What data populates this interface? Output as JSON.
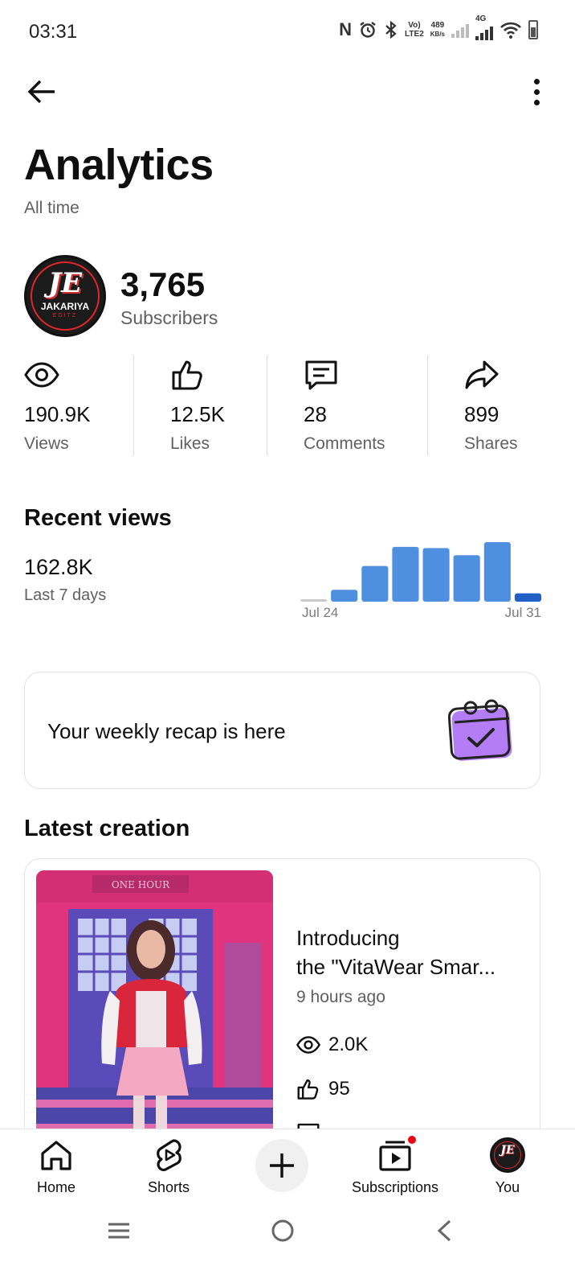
{
  "status_bar": {
    "time": "03:31",
    "volte": "Vo)",
    "lte": "LTE2",
    "speed_value": "489",
    "speed_unit": "KB/s",
    "network": "4G"
  },
  "header": {
    "title": "Analytics",
    "period": "All time"
  },
  "channel": {
    "avatar_text": "JE",
    "avatar_name": "JAKARIYA",
    "avatar_sub": "EDITZ",
    "subscriber_count": "3,765",
    "subscriber_label": "Subscribers"
  },
  "stats": [
    {
      "icon": "eye-icon",
      "value": "190.9K",
      "label": "Views"
    },
    {
      "icon": "thumbs-up-icon",
      "value": "12.5K",
      "label": "Likes"
    },
    {
      "icon": "comment-icon",
      "value": "28",
      "label": "Comments"
    },
    {
      "icon": "share-icon",
      "value": "899",
      "label": "Shares"
    }
  ],
  "recent_views": {
    "title": "Recent views",
    "value": "162.8K",
    "subtitle": "Last 7 days"
  },
  "chart_data": {
    "type": "bar",
    "categories": [
      "1",
      "2",
      "3",
      "4",
      "5",
      "6",
      "7",
      "8"
    ],
    "values": [
      0.04,
      0.2,
      0.6,
      0.92,
      0.9,
      0.78,
      1.0,
      0.14
    ],
    "x_tick_labels": [
      "Jul 24",
      "Jul 31"
    ],
    "colors": {
      "bar": "#4f8fe0",
      "last_bar": "#1f5fc6",
      "first_bar": "#c8c8c8"
    },
    "grid": false
  },
  "recap": {
    "text": "Your weekly recap is here",
    "icon": "calendar-check-icon",
    "icon_color": "#b57df5"
  },
  "latest_creation": {
    "title": "Latest creation",
    "video_title_line1": "Introducing",
    "video_title_line2": "the \"VitaWear Smar...",
    "time_ago": "9 hours ago",
    "views": "2.0K",
    "likes": "95",
    "thumbnail_sign": "ONE HOUR"
  },
  "bottom_nav": {
    "items": [
      {
        "label": "Home",
        "icon": "home-icon"
      },
      {
        "label": "Shorts",
        "icon": "shorts-icon"
      },
      {
        "label": "",
        "icon": "plus-icon"
      },
      {
        "label": "Subscriptions",
        "icon": "subscriptions-icon"
      },
      {
        "label": "You",
        "icon": "avatar"
      }
    ]
  },
  "colors": {
    "text_primary": "#0f0f0f",
    "text_secondary": "#606060",
    "accent_red": "#e50914"
  }
}
